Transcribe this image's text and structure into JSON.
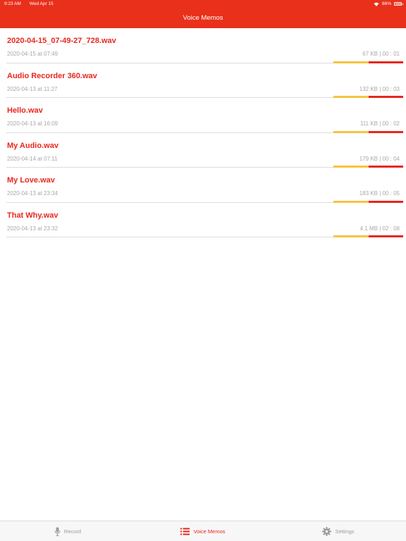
{
  "status_bar": {
    "time": "9:23 AM",
    "date": "Wed Apr 15",
    "battery_percent": "86%",
    "battery_level": 0.86
  },
  "nav": {
    "title": "Voice Memos"
  },
  "recordings": [
    {
      "title": "2020-04-15_07-49-27_728.wav",
      "date": "2020-04-15 at 07:49",
      "meta": "67 KB | 00 : 01"
    },
    {
      "title": "Audio Recorder 360.wav",
      "date": "2020-04-13 at 11:27",
      "meta": "132 KB | 00 : 03"
    },
    {
      "title": "Hello.wav",
      "date": "2020-04-13 at 16:09",
      "meta": "111 KB | 00 : 02"
    },
    {
      "title": "My Audio.wav",
      "date": "2020-04-14 at 07:11",
      "meta": "179 KB | 00 : 04"
    },
    {
      "title": "My Love.wav",
      "date": "2020-04-13 at 23:34",
      "meta": "183 KB | 00 : 05"
    },
    {
      "title": "That Why.wav",
      "date": "2020-04-13 at 23:32",
      "meta": "4.1 MB | 02 : 08"
    }
  ],
  "tabs": [
    {
      "label": "Record",
      "icon": "microphone-icon",
      "active": false
    },
    {
      "label": "Voice Memos",
      "icon": "list-icon",
      "active": true
    },
    {
      "label": "Settings",
      "icon": "gear-icon",
      "active": false
    }
  ],
  "colors": {
    "brand": "#e9301a",
    "title_red": "#e8271d",
    "bar_yellow": "#f5c441",
    "muted_text": "#a8a8a8"
  }
}
